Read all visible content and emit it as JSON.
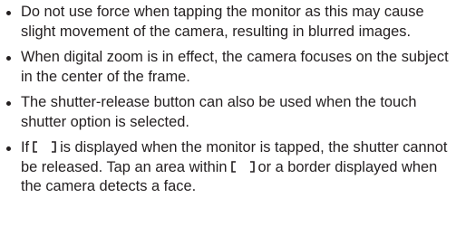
{
  "bullets": [
    {
      "text": "Do not use force when tapping the monitor as this may cause slight movement of the camera, resulting in blurred images."
    },
    {
      "text": "When digital zoom is in effect, the camera focuses on the subject in the center of the frame."
    },
    {
      "text": "The shutter-release button can also be used when the touch shutter option is selected."
    },
    {
      "part1": "If",
      "part2": "is displayed when the monitor is tapped, the shutter cannot be released. Tap an area within",
      "part3": "or a border displayed when the camera detects a face."
    }
  ],
  "icons": {
    "bullet": "bullet-dot-icon",
    "focus_frame": "focus-frame-icon"
  }
}
